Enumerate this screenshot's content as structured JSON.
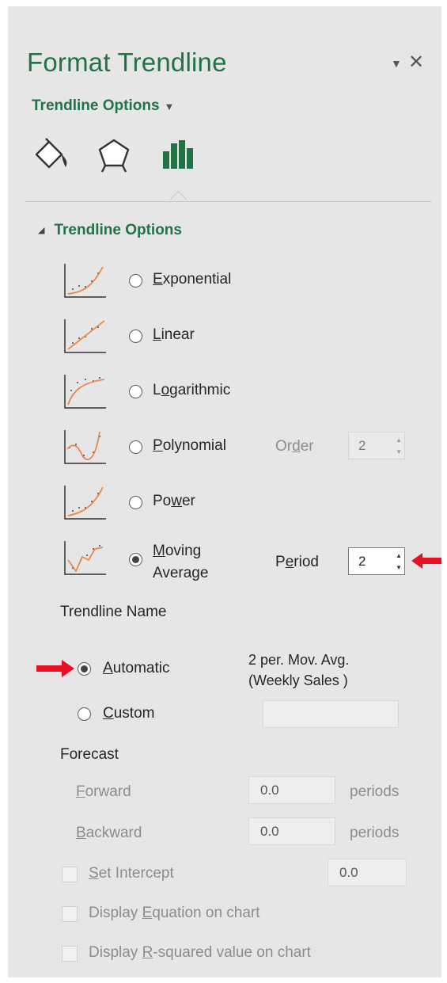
{
  "pane": {
    "title": "Format Trendline",
    "dropdown_icon": "chevron-down-icon",
    "close_icon": "close-icon",
    "subtitle": "Trendline Options",
    "tabs": [
      {
        "icon": "fill-line-icon"
      },
      {
        "icon": "effects-icon"
      },
      {
        "icon": "trendline-options-icon"
      }
    ]
  },
  "section": {
    "title": "Trendline Options",
    "types": [
      {
        "pre": "",
        "ul": "E",
        "post": "xponential",
        "selected": false
      },
      {
        "pre": "",
        "ul": "L",
        "post": "inear",
        "selected": false
      },
      {
        "pre": "L",
        "ul": "o",
        "post": "garithmic",
        "selected": false
      },
      {
        "pre": "",
        "ul": "P",
        "post": "olynomial",
        "selected": false
      },
      {
        "pre": "Po",
        "ul": "w",
        "post": "er",
        "selected": false
      },
      {
        "pre": "",
        "ul": "M",
        "post": "oving",
        "line2": "Average",
        "selected": true
      }
    ],
    "order": {
      "pre": "Or",
      "ul": "d",
      "post": "er",
      "value": "2"
    },
    "period": {
      "pre": "P",
      "ul": "e",
      "post": "riod",
      "value": "2"
    }
  },
  "name": {
    "heading": "Trendline Name",
    "automatic": {
      "pre": "",
      "ul": "A",
      "post": "utomatic",
      "selected": true
    },
    "auto_value_line1": "2 per. Mov. Avg.",
    "auto_value_line2": "(Weekly Sales )",
    "custom": {
      "pre": "",
      "ul": "C",
      "post": "ustom",
      "selected": false
    },
    "custom_value": ""
  },
  "forecast": {
    "heading": "Forecast",
    "forward": {
      "ul": "F",
      "post": "orward",
      "value": "0.0",
      "unit": "periods"
    },
    "backward": {
      "ul": "B",
      "post": "ackward",
      "value": "0.0",
      "unit": "periods"
    }
  },
  "options": {
    "intercept": {
      "ul": "S",
      "post": "et Intercept",
      "value": "0.0",
      "checked": false
    },
    "equation": {
      "pre": "Display ",
      "ul": "E",
      "post": "quation on chart",
      "checked": false
    },
    "rsquared": {
      "pre": "Display ",
      "ul": "R",
      "post": "-squared value on chart",
      "checked": false
    }
  },
  "colors": {
    "accent": "#217346",
    "trendline": "#e6894a",
    "callout": "#e81123"
  }
}
